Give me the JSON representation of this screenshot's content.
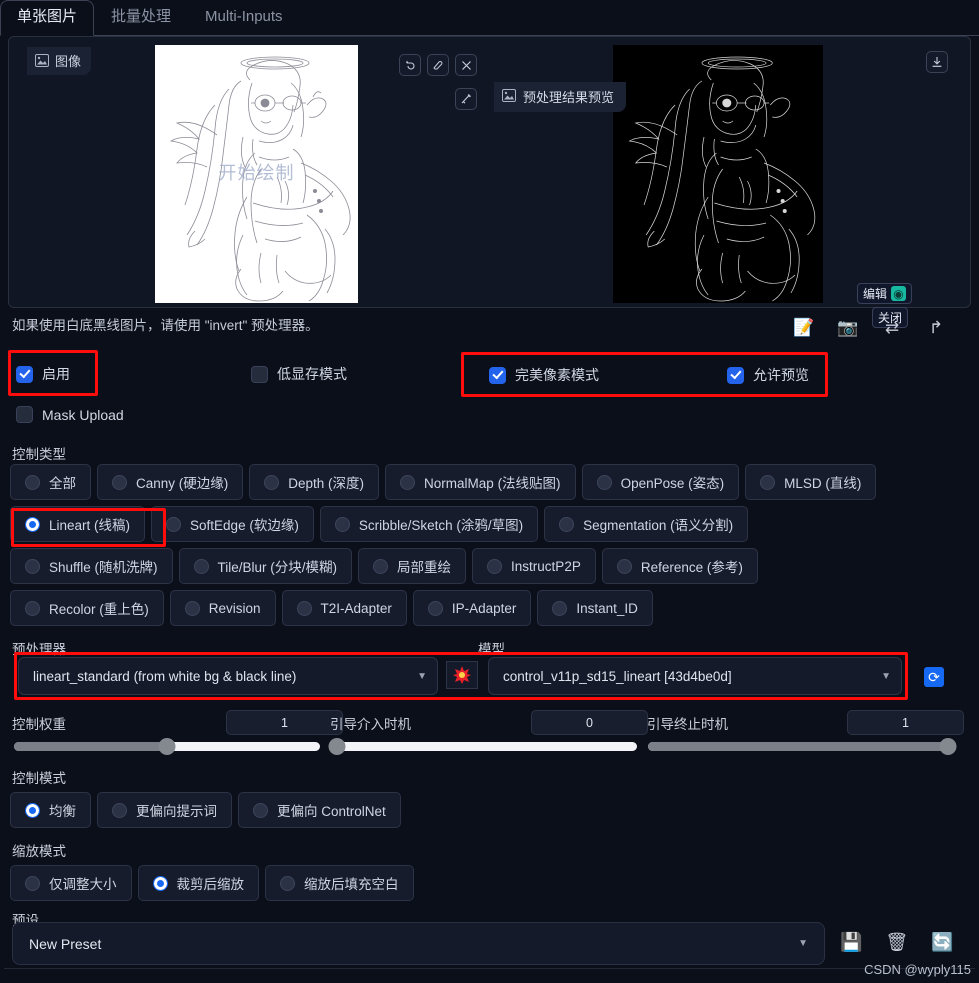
{
  "tabs": [
    {
      "label": "单张图片",
      "active": true
    },
    {
      "label": "批量处理",
      "active": false
    },
    {
      "label": "Multi-Inputs",
      "active": false
    }
  ],
  "image_panel": {
    "badge_label": "图像",
    "badge_icon": "image-icon",
    "preview_label": "预处理结果预览",
    "preview_icon": "image-icon",
    "source_watermark": "开始绘制",
    "tools": [
      {
        "name": "undo-icon",
        "glyph": "↺"
      },
      {
        "name": "eraser-icon",
        "glyph": "◌"
      },
      {
        "name": "close-icon",
        "glyph": "✕"
      },
      {
        "name": "brush-icon",
        "glyph": "✎"
      }
    ],
    "download_icon": "download-icon",
    "edit_label": "编辑",
    "close_label": "关闭"
  },
  "hint": "如果使用白底黑线图片，请使用 \"invert\" 预处理器。",
  "top_icons": [
    {
      "name": "note-edit-icon",
      "glyph": "📝"
    },
    {
      "name": "camera-icon",
      "glyph": "📷"
    },
    {
      "name": "swap-icon",
      "glyph": "⇄"
    },
    {
      "name": "send-to-icon",
      "glyph": "↱"
    }
  ],
  "checkboxes": [
    {
      "label": "启用",
      "checked": true,
      "highlighted": true
    },
    {
      "label": "低显存模式",
      "checked": false,
      "highlighted": false
    },
    {
      "label": "完美像素模式",
      "checked": true,
      "highlighted": true
    },
    {
      "label": "允许预览",
      "checked": true,
      "highlighted": true
    },
    {
      "label": "Mask Upload",
      "checked": false,
      "highlighted": false
    }
  ],
  "control_type": {
    "label": "控制类型",
    "rows": [
      [
        {
          "label": "全部",
          "selected": false
        },
        {
          "label": "Canny (硬边缘)",
          "selected": false
        },
        {
          "label": "Depth (深度)",
          "selected": false
        },
        {
          "label": "NormalMap (法线贴图)",
          "selected": false
        },
        {
          "label": "OpenPose (姿态)",
          "selected": false
        },
        {
          "label": "MLSD (直线)",
          "selected": false
        }
      ],
      [
        {
          "label": "Lineart (线稿)",
          "selected": true
        },
        {
          "label": "SoftEdge (软边缘)",
          "selected": false
        },
        {
          "label": "Scribble/Sketch (涂鸦/草图)",
          "selected": false
        },
        {
          "label": "Segmentation (语义分割)",
          "selected": false
        }
      ],
      [
        {
          "label": "Shuffle (随机洗牌)",
          "selected": false
        },
        {
          "label": "Tile/Blur (分块/模糊)",
          "selected": false
        },
        {
          "label": "局部重绘",
          "selected": false
        },
        {
          "label": "InstructP2P",
          "selected": false
        },
        {
          "label": "Reference (参考)",
          "selected": false
        }
      ],
      [
        {
          "label": "Recolor (重上色)",
          "selected": false
        },
        {
          "label": "Revision",
          "selected": false
        },
        {
          "label": "T2I-Adapter",
          "selected": false
        },
        {
          "label": "IP-Adapter",
          "selected": false
        },
        {
          "label": "Instant_ID",
          "selected": false
        }
      ]
    ]
  },
  "preprocessor": {
    "label": "预处理器",
    "value": "lineart_standard (from white bg & black line)",
    "run_icon": "burst-icon"
  },
  "model": {
    "label": "模型",
    "value": "control_v11p_sd15_lineart [43d4be0d]",
    "refresh_icon": "refresh-icon"
  },
  "sliders": [
    {
      "label": "控制权重",
      "value": "1",
      "percent": 50
    },
    {
      "label": "引导介入时机",
      "value": "0",
      "percent": 0
    },
    {
      "label": "引导终止时机",
      "value": "1",
      "percent": 100
    }
  ],
  "control_mode": {
    "label": "控制模式",
    "options": [
      {
        "label": "均衡",
        "selected": true
      },
      {
        "label": "更偏向提示词",
        "selected": false
      },
      {
        "label": "更偏向 ControlNet",
        "selected": false
      }
    ]
  },
  "resize_mode": {
    "label": "缩放模式",
    "options": [
      {
        "label": "仅调整大小",
        "selected": false
      },
      {
        "label": "裁剪后缩放",
        "selected": true
      },
      {
        "label": "缩放后填充空白",
        "selected": false
      }
    ]
  },
  "preset": {
    "label": "预设",
    "value": "New Preset",
    "icons": [
      {
        "name": "save-icon",
        "glyph": "💾"
      },
      {
        "name": "trash-icon",
        "glyph": "🗑"
      },
      {
        "name": "refresh-icon",
        "glyph": "🔄"
      }
    ]
  },
  "watermark": "CSDN @wyply115",
  "colors": {
    "accent_blue": "#1668f5",
    "highlight_red": "#ff0d0d",
    "teal": "#16b8a0",
    "panel_bg": "#111624",
    "page_bg": "#0b0f19"
  }
}
